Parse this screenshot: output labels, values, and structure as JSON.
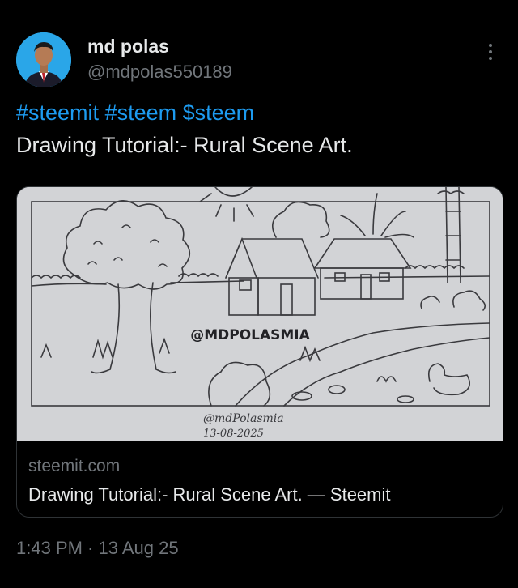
{
  "author": {
    "name": "md polas",
    "handle": "@mdpolas550189",
    "avatar_icon": "profile-photo"
  },
  "tweet": {
    "hashtags": [
      "#steemit",
      "#steem",
      "$steem"
    ],
    "text": "Drawing Tutorial:- Rural Scene Art."
  },
  "card": {
    "image_overlay_text": "@MDPOLASMIA",
    "image_signature": "@mdPolasmia",
    "image_date": "13-08-2025",
    "domain": "steemit.com",
    "title": "Drawing Tutorial:- Rural Scene Art. — Steemit"
  },
  "timestamp": "1:43 PM · 13 Aug 25",
  "colors": {
    "background": "#000000",
    "link": "#1d9bf0",
    "primary_text": "#e7e9ea",
    "secondary_text": "#71767b",
    "border": "#2f3336"
  }
}
